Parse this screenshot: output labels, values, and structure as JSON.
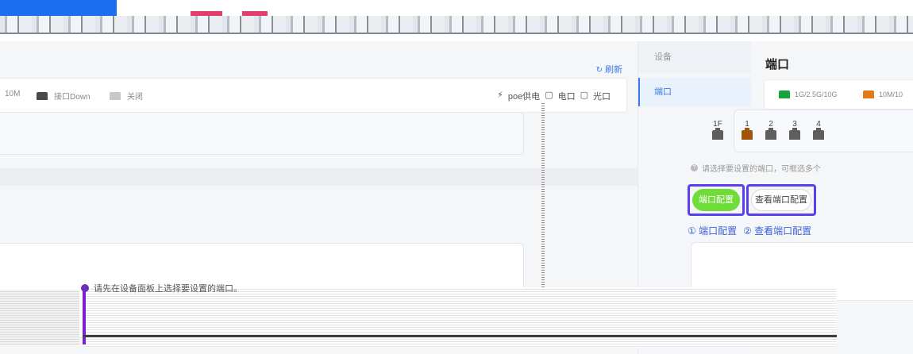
{
  "main": {
    "refresh_label": "刷新",
    "legend": [
      {
        "label": "10M",
        "color": "#3a3a3a"
      },
      {
        "label": "接口Down",
        "color": "#4a4a4a"
      },
      {
        "label": "关闭",
        "color": "#c8c8c8"
      }
    ],
    "port_kinds": [
      "poe供电",
      "电口",
      "光口"
    ],
    "tooltip": "请先在设备面板上选择要设置的端口。"
  },
  "nav": {
    "header": "设备",
    "items": [
      {
        "label": "端口"
      }
    ]
  },
  "right": {
    "title": "端口",
    "legend": [
      {
        "label": "1G/2.5G/10G",
        "color": "#1aa33b"
      },
      {
        "label": "10M/10",
        "color": "#e07b16"
      }
    ],
    "ports": [
      {
        "num": "1F",
        "color": "#5e5e5e"
      },
      {
        "num": "1",
        "color": "#a0550b"
      },
      {
        "num": "2",
        "color": "#5e5e5e"
      },
      {
        "num": "3",
        "color": "#5e5e5e"
      },
      {
        "num": "4",
        "color": "#5e5e5e"
      }
    ],
    "hint": "请选择要设置的端口，可框选多个",
    "buttons": {
      "config": "端口配置",
      "view": "查看端口配置"
    },
    "steps": [
      "① 端口配置",
      "② 查看端口配置"
    ]
  }
}
